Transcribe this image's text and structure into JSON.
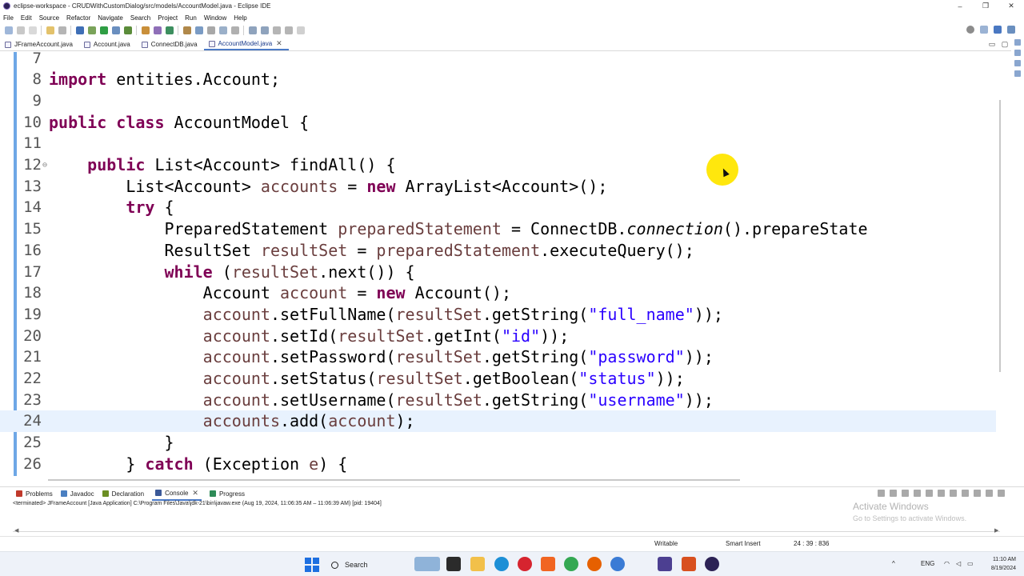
{
  "window": {
    "title": "eclipse-workspace - CRUDWithCustomDialog/src/models/AccountModel.java - Eclipse IDE",
    "controls": [
      "–",
      "❐",
      "✕"
    ]
  },
  "menu": [
    "File",
    "Edit",
    "Source",
    "Refactor",
    "Navigate",
    "Search",
    "Project",
    "Run",
    "Window",
    "Help"
  ],
  "editor_tabs": [
    {
      "label": "JFrameAccount.java",
      "active": false
    },
    {
      "label": "Account.java",
      "active": false
    },
    {
      "label": "ConnectDB.java",
      "active": false
    },
    {
      "label": "AccountModel.java",
      "active": true,
      "close": "✕"
    }
  ],
  "code_lines": [
    {
      "n": "7",
      "html": ""
    },
    {
      "n": "8",
      "html": "<span class=\"kw\">import</span> entities.Account;"
    },
    {
      "n": "9",
      "html": ""
    },
    {
      "n": "10",
      "html": "<span class=\"kw\">public</span> <span class=\"kw\">class</span> AccountModel {"
    },
    {
      "n": "11",
      "html": ""
    },
    {
      "n": "12",
      "fold": "⊖",
      "html": "    <span class=\"kw\">public</span> List&lt;Account&gt; findAll() {"
    },
    {
      "n": "13",
      "html": "        List&lt;Account&gt; <span class=\"vr\">accounts</span> = <span class=\"kw\">new</span> ArrayList&lt;Account&gt;();"
    },
    {
      "n": "14",
      "html": "        <span class=\"kw\">try</span> {"
    },
    {
      "n": "15",
      "html": "            PreparedStatement <span class=\"vr\">preparedStatement</span> = ConnectDB.<span class=\"it\">connection</span>().prepareState"
    },
    {
      "n": "16",
      "html": "            ResultSet <span class=\"vr\">resultSet</span> = <span class=\"vr\">preparedStatement</span>.executeQuery();"
    },
    {
      "n": "17",
      "html": "            <span class=\"kw\">while</span> (<span class=\"vr\">resultSet</span>.next()) {"
    },
    {
      "n": "18",
      "html": "                Account <span class=\"vr\">account</span> = <span class=\"kw\">new</span> Account();"
    },
    {
      "n": "19",
      "html": "                <span class=\"vr\">account</span>.setFullName(<span class=\"vr\">resultSet</span>.getString(<span class=\"st\">\"full_name\"</span>));"
    },
    {
      "n": "20",
      "html": "                <span class=\"vr\">account</span>.setId(<span class=\"vr\">resultSet</span>.getInt(<span class=\"st\">\"id\"</span>));"
    },
    {
      "n": "21",
      "html": "                <span class=\"vr\">account</span>.setPassword(<span class=\"vr\">resultSet</span>.getString(<span class=\"st\">\"password\"</span>));"
    },
    {
      "n": "22",
      "html": "                <span class=\"vr\">account</span>.setStatus(<span class=\"vr\">resultSet</span>.getBoolean(<span class=\"st\">\"status\"</span>));"
    },
    {
      "n": "23",
      "html": "                <span class=\"vr\">account</span>.setUsername(<span class=\"vr\">resultSet</span>.getString(<span class=\"st\">\"username\"</span>));"
    },
    {
      "n": "24",
      "current": true,
      "html": "                <span class=\"vr\">accounts</span>.add(<span class=\"vr\">account</span>);"
    },
    {
      "n": "25",
      "html": "            }"
    },
    {
      "n": "26",
      "html": "        } <span class=\"kw\">catch</span> (Exception <span class=\"vr\">e</span>) {"
    }
  ],
  "views": {
    "tabs": [
      {
        "label": "Problems",
        "color": "#c0392b"
      },
      {
        "label": "Javadoc",
        "color": "#4a7fc1"
      },
      {
        "label": "Declaration",
        "color": "#6b8e23"
      },
      {
        "label": "Console",
        "color": "#3b5998",
        "active": true,
        "close": "✕"
      },
      {
        "label": "Progress",
        "color": "#2e8b57"
      }
    ],
    "console_header": "<terminated> JFrameAccount [Java Application] C:\\Program Files\\Java\\jdk-21\\bin\\javaw.exe  (Aug 19, 2024, 11:06:35 AM – 11:06:39 AM) [pid: 19404]"
  },
  "watermark": {
    "title": "Activate Windows",
    "subtitle": "Go to Settings to activate Windows."
  },
  "status": {
    "writable": "Writable",
    "insert_mode": "Smart Insert",
    "position": "24 : 39 : 836"
  },
  "taskbar": {
    "search_label": "Search",
    "lang": "ENG",
    "time": "11:10 AM",
    "date": "8/19/2024"
  },
  "colors": {
    "keyword": "#7f0055",
    "variable": "#6a3e3e",
    "string": "#2a00ff",
    "current_line": "#e8f2fe",
    "cursor_highlight": "#ffe600"
  }
}
